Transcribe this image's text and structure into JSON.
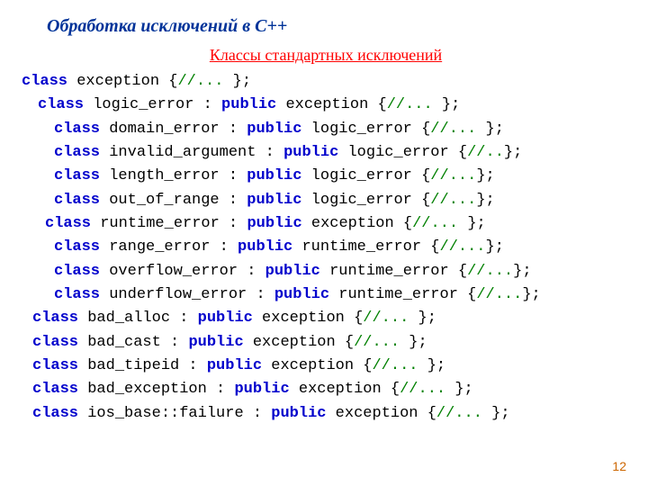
{
  "title": "Обработка исключений в С++",
  "subhead": " Классы стандартных исключений",
  "pagenum": "12",
  "kw_class": "class",
  "kw_public": "public",
  "lines": [
    {
      "indent": "ind0",
      "name": "exception",
      "seg1": " exception {",
      "comment": "//... ",
      "seg2": "};"
    },
    {
      "indent": "ind1",
      "name": "logic_error",
      "seg1": " logic_error : ",
      "base": " exception {",
      "comment": "//... ",
      "seg2": "};"
    },
    {
      "indent": "ind2",
      "name": "domain_error",
      "seg1": " domain_error : ",
      "base": " logic_error {",
      "comment": "//... ",
      "seg2": "};"
    },
    {
      "indent": "ind2",
      "name": "invalid_argument",
      "seg1": " invalid_argument : ",
      "base": " logic_error {",
      "comment": "//..",
      "seg2": "};"
    },
    {
      "indent": "ind2",
      "name": "length_error",
      "seg1": " length_error : ",
      "base": " logic_error {",
      "comment": "//...",
      "seg2": "};"
    },
    {
      "indent": "ind2",
      "name": "out_of_range",
      "seg1": " out_of_range : ",
      "base": " logic_error {",
      "comment": "//...",
      "seg2": "};"
    },
    {
      "indent": "ind3",
      "name": "runtime_error",
      "seg1": " runtime_error : ",
      "base": " exception {",
      "comment": "//... ",
      "seg2": "};"
    },
    {
      "indent": "ind2",
      "name": "range_error",
      "seg1": " range_error : ",
      "base": " runtime_error {",
      "comment": "//...",
      "seg2": "};"
    },
    {
      "indent": "ind2",
      "name": "overflow_error",
      "seg1": " overflow_error : ",
      "base": " runtime_error {",
      "comment": "//...",
      "seg2": "};"
    },
    {
      "indent": "ind2",
      "name": "underflow_error",
      "seg1": " underflow_error : ",
      "base": " runtime_error {",
      "comment": "//...",
      "seg2": "};"
    },
    {
      "indent": "ind4",
      "name": "bad_alloc",
      "seg1": " bad_alloc : ",
      "base": " exception {",
      "comment": "//... ",
      "seg2": "};"
    },
    {
      "indent": "ind4",
      "name": "bad_cast",
      "seg1": " bad_cast : ",
      "base": " exception {",
      "comment": "//... ",
      "seg2": "};"
    },
    {
      "indent": "ind4",
      "name": "bad_tipeid",
      "seg1": " bad_tipeid : ",
      "base": " exception {",
      "comment": "//... ",
      "seg2": "};"
    },
    {
      "indent": "ind4",
      "name": "bad_exception",
      "seg1": " bad_exception : ",
      "base": " exception {",
      "comment": "//... ",
      "seg2": "};"
    },
    {
      "indent": "ind4",
      "name": "ios_base_failure",
      "seg1": " ios_base::failure : ",
      "base": " exception {",
      "comment": "//... ",
      "seg2": "};"
    }
  ]
}
